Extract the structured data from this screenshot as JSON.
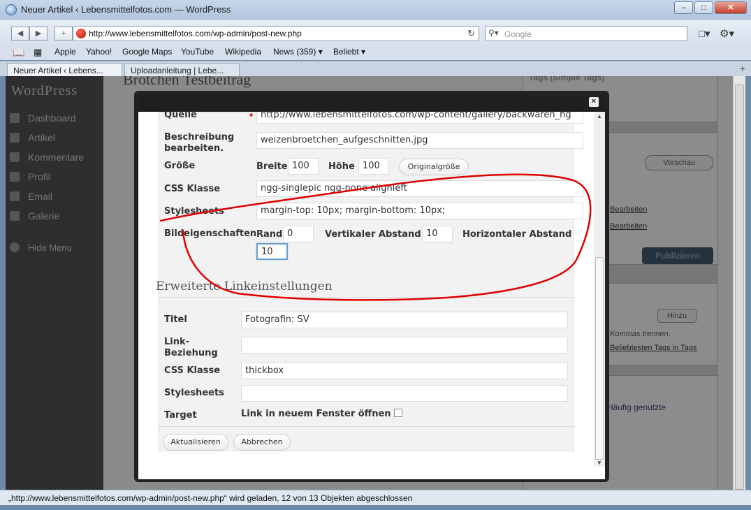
{
  "window": {
    "title": "Neuer Artikel ‹ Lebensmittelfotos.com — WordPress"
  },
  "toolbar": {
    "url": "http://www.lebensmittelfotos.com/wp-admin/post-new.php",
    "search_placeholder": "Google"
  },
  "bookmarks": [
    "Apple",
    "Yahoo!",
    "Google Maps",
    "YouTube",
    "Wikipedia",
    "News (359)",
    "Beliebt"
  ],
  "tabs": [
    "Neuer Artikel ‹ Lebens...",
    "Uploadanleitung | Lebe..."
  ],
  "background_page": {
    "logo": "WordPress",
    "title": "Brötchen Testbeitrag",
    "menu": [
      "Dashboard",
      "Artikel",
      "Kommentare",
      "Profil",
      "Email",
      "Galerie",
      "Hide Menu"
    ],
    "right": {
      "tags_box": "Tags (Simple Tags)",
      "preview": "Vorschau",
      "publish": "Publizieren",
      "hinzu": "Hinzu",
      "commas": "Kommas trennen.",
      "popular": "Beliebtesten Tags in Tags",
      "frequent": "Häufig genutzte",
      "edit1": "Bearbeiten",
      "edit2": "Bearbeiten"
    }
  },
  "modal": {
    "quelle_label": "Quelle",
    "quelle_value": "http://www.lebensmittelfotos.com/wp-content/gallery/backwaren_hg",
    "beschreibung_label": "Beschreibung bearbeiten.",
    "beschreibung_value": "weizenbroetchen_aufgeschnitten.jpg",
    "groesse_label": "Größe",
    "breite_label": "Breite",
    "breite_value": "100",
    "hoehe_label": "Höhe",
    "hoehe_value": "100",
    "originalgroesse_button": "Originalgröße",
    "css_label": "CSS Klasse",
    "css_value": "ngg-singlepic ngg-none alignleft",
    "stylesheets_label": "Stylesheets",
    "stylesheets_value": "margin-top: 10px; margin-bottom: 10px;",
    "bildeigenschaften_label": "Bildeigenschaften",
    "rand_label": "Rand",
    "rand_value": "0",
    "vertikal_label": "Vertikaler Abstand",
    "vertikal_value": "10",
    "horizontal_label": "Horizontaler Abstand",
    "horizontal_value": "10",
    "section_title": "Erweiterte Linkeinstellungen",
    "titel_label": "Titel",
    "titel_value": "Fotografin: SV",
    "link_label": "Link-Beziehung",
    "link_value": "",
    "css2_label": "CSS Klasse",
    "css2_value": "thickbox",
    "stylesheets2_label": "Stylesheets",
    "stylesheets2_value": "",
    "target_label": "Target",
    "target_text": "Link in neuem Fenster öffnen",
    "update_button": "Aktualisieren",
    "cancel_button": "Abbrechen",
    "close": "×"
  },
  "status": {
    "text": "„http://www.lebensmittelfotos.com/wp-admin/post-new.php“ wird geladen, 12 von 13 Objekten abgeschlossen"
  },
  "colors": {
    "annotation": "#e00000",
    "focus": "#6a9fd4",
    "publish": "#24323e"
  }
}
